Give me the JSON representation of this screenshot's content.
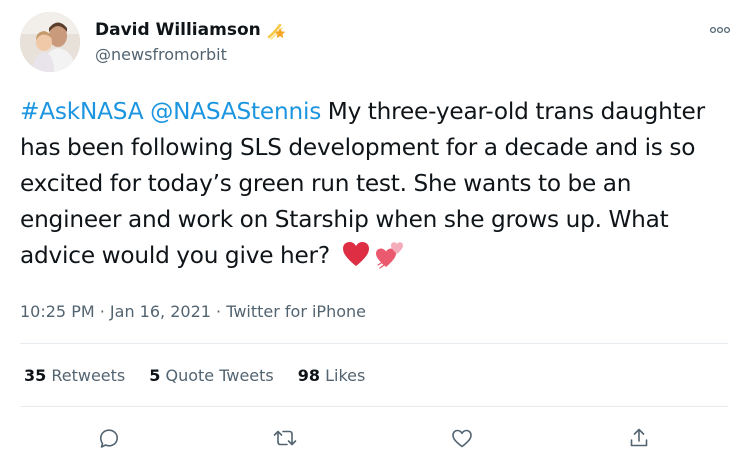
{
  "author": {
    "display_name": "David Williamson",
    "handle": "@newsfromorbit",
    "name_emoji": "shooting-star-emoji"
  },
  "tweet": {
    "hashtag": "#AskNASA",
    "mention": "@NASAStennis",
    "text": " My three-year-old trans daughter has been following SLS development for a decade and is so excited for today’s green run test. She wants to be an engineer and work on Starship when she grows up. What advice would you give her? ",
    "emojis": [
      "red-heart-emoji",
      "two-hearts-emoji"
    ]
  },
  "meta": {
    "time": "10:25 PM",
    "separator1": " · ",
    "date": "Jan 16, 2021",
    "separator2": " · ",
    "source": "Twitter for iPhone"
  },
  "stats": {
    "retweets_count": "35",
    "retweets_label": "Retweets",
    "quotes_count": "5",
    "quotes_label": "Quote Tweets",
    "likes_count": "98",
    "likes_label": "Likes"
  },
  "actions": {
    "reply_icon": "reply-icon",
    "retweet_icon": "retweet-icon",
    "like_icon": "like-icon",
    "share_icon": "share-icon"
  },
  "colors": {
    "link": "#1b95e0",
    "secondary_text": "#536471",
    "primary_text": "#0f1419",
    "divider": "#e6ecf0",
    "heart": "#e0245e"
  }
}
